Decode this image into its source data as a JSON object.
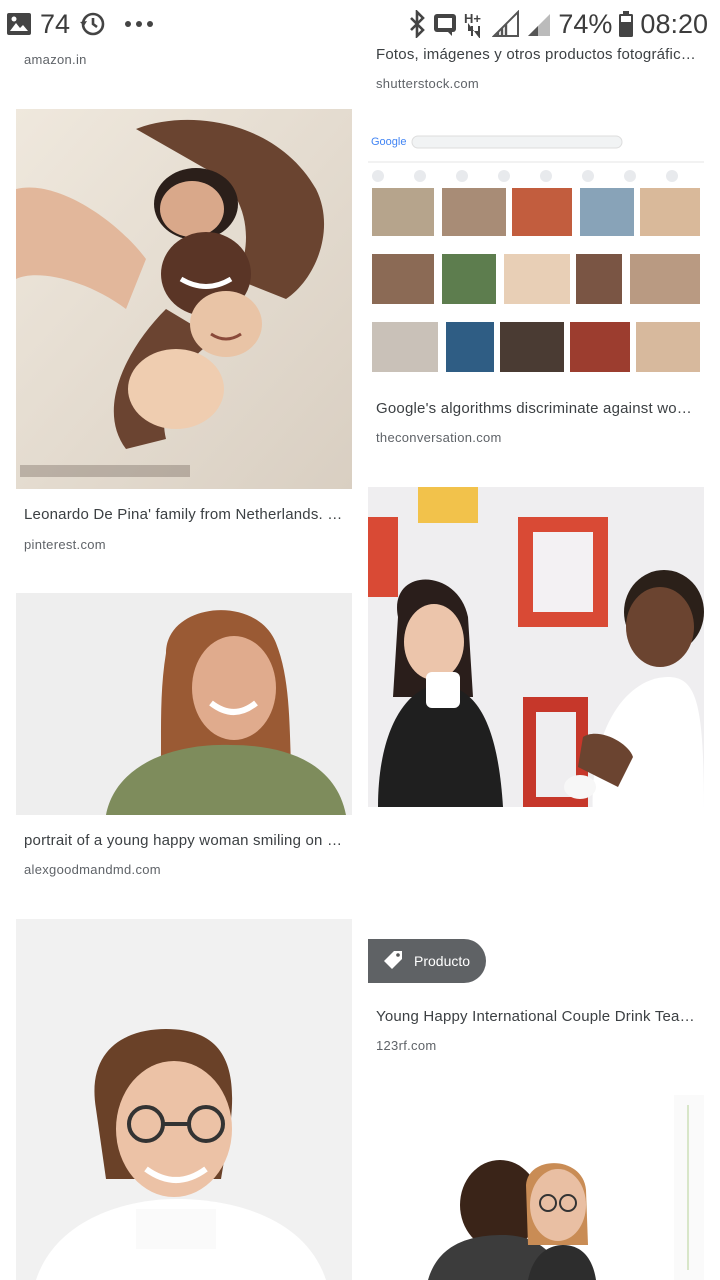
{
  "status_bar": {
    "notification_count": "74",
    "battery_percent": "74%",
    "time": "08:20",
    "icons_left": [
      "gallery-icon",
      "history-icon",
      "more-dots-icon"
    ],
    "icons_right": [
      "bluetooth-icon",
      "cast-icon",
      "hplus-data-icon",
      "signal-icon",
      "signal-icon",
      "battery-icon"
    ]
  },
  "results": {
    "left": [
      {
        "caption": "",
        "source": "amazon.in"
      },
      {
        "caption": "Leonardo De Pina' family from Netherlands. E…",
        "source": "pinterest.com"
      },
      {
        "caption": "portrait of a young happy woman smiling on w…",
        "source": "alexgoodmandmd.com"
      },
      {
        "caption": "",
        "source": ""
      }
    ],
    "right": [
      {
        "caption": "Fotos, imágenes y otros productos fotográfic…",
        "source": "shutterstock.com"
      },
      {
        "caption": "Google's algorithms discriminate against wo…",
        "source": "theconversation.com",
        "logo_text": "Google"
      },
      {
        "caption": "Young Happy International Couple Drink Tea O…",
        "source": "123rf.com",
        "badge": "Producto"
      },
      {
        "caption": "",
        "source": ""
      }
    ]
  },
  "colors": {
    "caption": "#3c4043",
    "source": "#5f6368",
    "badge_bg": "#3c4043"
  }
}
